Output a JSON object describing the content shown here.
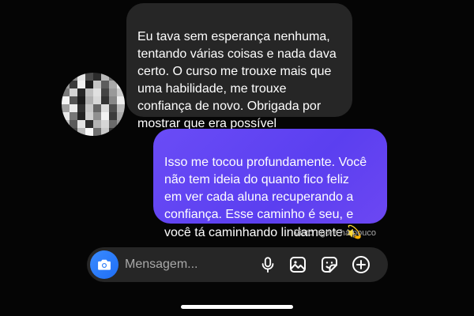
{
  "conversation": {
    "incoming_message": "Eu tava sem esperança nenhuma,\ntentando várias coisas e nada dava\ncerto. O curso me trouxe mais que\numa habilidade, me trouxe\nconfiança de novo. Obrigada por\nmostrar que era possível",
    "outgoing_message": "Isso me tocou profundamente. Você\nnão tem ideia do quanto fico feliz\nem ver cada aluna recuperando a\nconfiança. Esse caminho é seu, e\nvocê tá caminhando lindamente ",
    "outgoing_emoji": "💫",
    "seen_status": "Visto agora há pouco"
  },
  "composer": {
    "placeholder": "Mensagem...",
    "value": "",
    "camera_icon": "camera-icon",
    "tools": [
      "microphone-icon",
      "gallery-icon",
      "sticker-icon",
      "plus-circle-icon"
    ]
  },
  "colors": {
    "background": "#050505",
    "incoming_bubble": "#262626",
    "outgoing_bubble": "#5b3ff0",
    "camera_button": "#2a7cf8",
    "muted_text": "#a8a8a8"
  }
}
